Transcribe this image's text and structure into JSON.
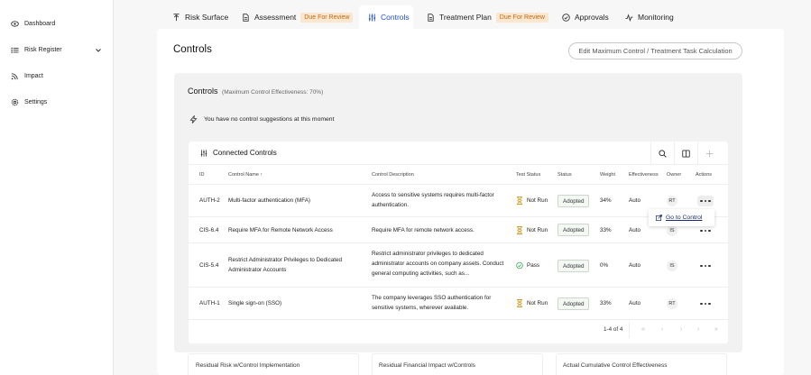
{
  "sidebar": {
    "items": [
      {
        "label": "Dashboard",
        "icon": "eye-icon"
      },
      {
        "label": "Risk Register",
        "icon": "list-icon"
      },
      {
        "label": "Impact",
        "icon": "signal-icon"
      },
      {
        "label": "Settings",
        "icon": "gear-icon"
      }
    ]
  },
  "tabs": [
    {
      "label": "Risk Surface",
      "icon": "upload-icon"
    },
    {
      "label": "Assessment",
      "icon": "document-icon",
      "badge": "Due For Review"
    },
    {
      "label": "Controls",
      "icon": "sliders-icon",
      "active": true
    },
    {
      "label": "Treatment Plan",
      "icon": "document-icon",
      "badge": "Due For Review"
    },
    {
      "label": "Approvals",
      "icon": "check-circle-icon"
    },
    {
      "label": "Monitoring",
      "icon": "pulse-icon"
    }
  ],
  "page": {
    "title": "Controls",
    "edit_button": "Edit Maximum Control / Treatment Task Calculation"
  },
  "panel": {
    "title": "Controls",
    "subtitle": "(Maximum Control Effectiveness: 70%)",
    "suggestion": "You have no control suggestions at this moment"
  },
  "table": {
    "title": "Connected Controls",
    "headers": {
      "id": "ID",
      "name": "Control Name",
      "description": "Control Description",
      "test_status": "Test Status",
      "status": "Status",
      "weight": "Weight",
      "effectiveness": "Effectiveness",
      "owner": "Owner",
      "actions": "Actions"
    },
    "rows": [
      {
        "id": "AUTH-2",
        "name": "Multi-factor authentication (MFA)",
        "description": "Access to sensitive systems requires multi-factor authentication.",
        "test_status": "Not Run",
        "status": "Adopted",
        "weight": "34%",
        "effectiveness": "Auto",
        "owner": "RT"
      },
      {
        "id": "CIS-6.4",
        "name": "Require MFA for Remote Network Access",
        "description": "Require MFA for remote network access.",
        "test_status": "Not Run",
        "status": "Adopted",
        "weight": "33%",
        "effectiveness": "Auto",
        "owner": "IS"
      },
      {
        "id": "CIS-5.4",
        "name": "Restrict Administrator Privileges to Dedicated Administrator Accounts",
        "description": "Restrict administrator privileges to dedicated administrator accounts on company assets. Conduct general computing activities, such as...",
        "test_status": "Pass",
        "status": "Adopted",
        "weight": "0%",
        "effectiveness": "Auto",
        "owner": "IS"
      },
      {
        "id": "AUTH-1",
        "name": "Single sign-on (SSO)",
        "description": "The company leverages SSO authentication for sensitive systems, wherever available.",
        "test_status": "Not Run",
        "status": "Adopted",
        "weight": "33%",
        "effectiveness": "Auto",
        "owner": "RT"
      }
    ],
    "popup": "Go to Control",
    "pagination": "1-4 of 4"
  },
  "bottom_cards": [
    {
      "title": "Residual Risk w/Control Implementation"
    },
    {
      "title": "Residual Financial Impact w/Controls"
    },
    {
      "title": "Actual Cumulative Control Effectiveness"
    }
  ],
  "colors": {
    "accent": "#1f4fd0",
    "badge_bg": "#fbe7cf",
    "badge_text": "#c06a12",
    "not_run": "#d99a2b",
    "pass": "#3aa655"
  }
}
